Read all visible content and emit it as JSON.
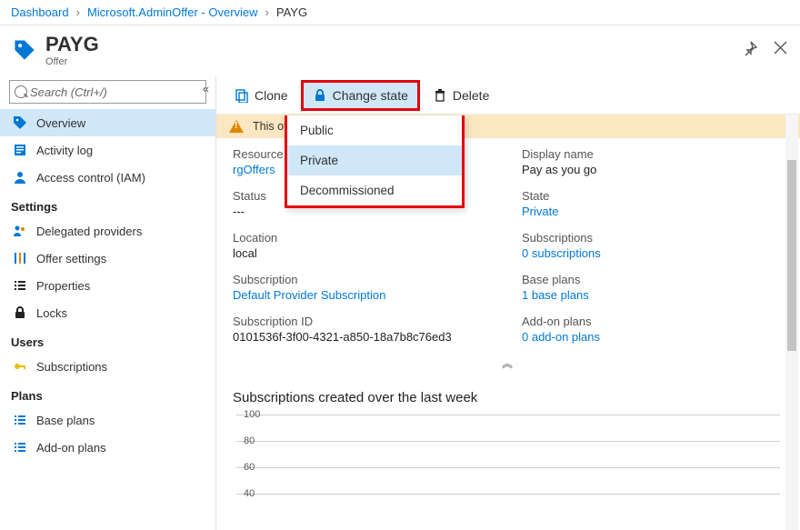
{
  "breadcrumbs": [
    "Dashboard",
    "Microsoft.AdminOffer - Overview",
    "PAYG"
  ],
  "header": {
    "title": "PAYG",
    "subtitle": "Offer"
  },
  "search": {
    "placeholder": "Search (Ctrl+/)"
  },
  "nav": {
    "top": [
      {
        "label": "Overview",
        "name": "overview",
        "active": true
      },
      {
        "label": "Activity log",
        "name": "activity-log"
      },
      {
        "label": "Access control (IAM)",
        "name": "access-control"
      }
    ],
    "groups": [
      {
        "title": "Settings",
        "items": [
          {
            "label": "Delegated providers",
            "name": "delegated-providers"
          },
          {
            "label": "Offer settings",
            "name": "offer-settings"
          },
          {
            "label": "Properties",
            "name": "properties"
          },
          {
            "label": "Locks",
            "name": "locks"
          }
        ]
      },
      {
        "title": "Users",
        "items": [
          {
            "label": "Subscriptions",
            "name": "subscriptions"
          }
        ]
      },
      {
        "title": "Plans",
        "items": [
          {
            "label": "Base plans",
            "name": "base-plans"
          },
          {
            "label": "Add-on plans",
            "name": "addon-plans"
          }
        ]
      }
    ]
  },
  "toolbar": {
    "clone": "Clone",
    "change": "Change state",
    "delete": "Delete"
  },
  "change_state_menu": [
    "Public",
    "Private",
    "Decommissioned"
  ],
  "warning_prefix": "This of",
  "properties": {
    "resource_group": {
      "label": "Resource group",
      "value": "rgOffers",
      "link": true
    },
    "display_name": {
      "label": "Display name",
      "value": "Pay as you go"
    },
    "status": {
      "label": "Status",
      "value": "---"
    },
    "state": {
      "label": "State",
      "value": "Private",
      "link": true
    },
    "location": {
      "label": "Location",
      "value": "local"
    },
    "subscriptions": {
      "label": "Subscriptions",
      "value": "0 subscriptions",
      "link": true
    },
    "subscription": {
      "label": "Subscription",
      "value": "Default Provider Subscription",
      "link": true
    },
    "base_plans": {
      "label": "Base plans",
      "value": "1 base plans",
      "link": true
    },
    "subscription_id": {
      "label": "Subscription ID",
      "value": "0101536f-3f00-4321-a850-18a7b8c76ed3"
    },
    "addon_plans": {
      "label": "Add-on plans",
      "value": "0 add-on plans",
      "link": true
    }
  },
  "chart_section_title": "Subscriptions created over the last week",
  "chart_data": {
    "type": "line",
    "title": "Subscriptions created over the last week",
    "xlabel": "",
    "ylabel": "",
    "ylim": [
      0,
      100
    ],
    "y_ticks": [
      100,
      80,
      60,
      40
    ],
    "series": [
      {
        "name": "Subscriptions",
        "values": []
      }
    ],
    "categories": []
  }
}
